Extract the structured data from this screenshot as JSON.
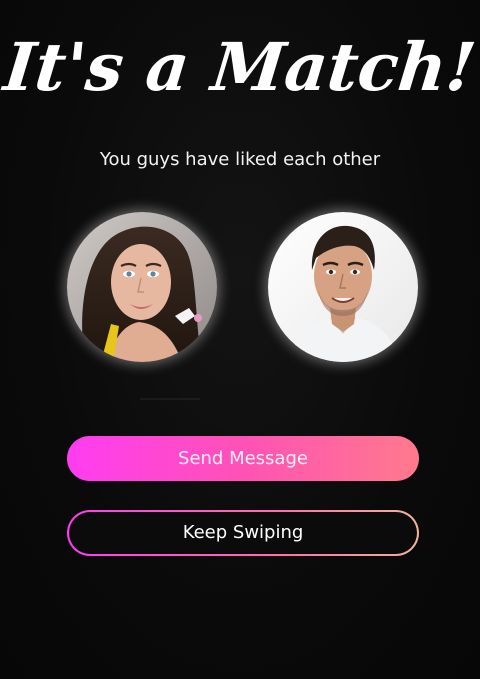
{
  "match": {
    "title": "It's a Match!",
    "subtitle": "You guys have liked each other"
  },
  "profiles": [
    {
      "name": "matched-user-photo",
      "hair": "#3a2a22",
      "skin": "#e4b49a"
    },
    {
      "name": "current-user-photo",
      "hair": "#2b1f1a",
      "skin": "#d9a889"
    }
  ],
  "actions": {
    "send_message_label": "Send Message",
    "keep_swiping_label": "Keep Swiping"
  },
  "colors": {
    "accent_start": "#ff3cf2",
    "accent_end": "#ff7a8c",
    "background": "#0b0b0b"
  }
}
